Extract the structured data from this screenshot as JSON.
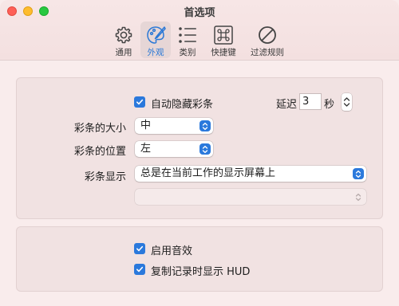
{
  "window": {
    "title": "首选项"
  },
  "toolbar": {
    "tabs": [
      {
        "label": "通用",
        "icon": "gear-icon"
      },
      {
        "label": "外观",
        "icon": "paintbrush-palette-icon",
        "active": true
      },
      {
        "label": "类别",
        "icon": "list-icon"
      },
      {
        "label": "快捷键",
        "icon": "command-key-icon"
      },
      {
        "label": "过滤规则",
        "icon": "prohibited-icon"
      }
    ]
  },
  "appearance": {
    "auto_hide_label": "自动隐藏彩条",
    "auto_hide_checked": true,
    "delay_label": "延迟",
    "delay_value": "3",
    "delay_unit": "秒",
    "size_label": "彩条的大小",
    "size_value": "中",
    "position_label": "彩条的位置",
    "position_value": "左",
    "display_label": "彩条显示",
    "display_value": "总是在当前工作的显示屏幕上",
    "secondary_display_value": ""
  },
  "sound": {
    "sound_label": "启用音效",
    "sound_checked": true,
    "hud_label": "复制记录时显示 HUD",
    "hud_checked": true
  },
  "colors": {
    "accent": "#2b79dc",
    "window_bg": "#f9ecec"
  }
}
